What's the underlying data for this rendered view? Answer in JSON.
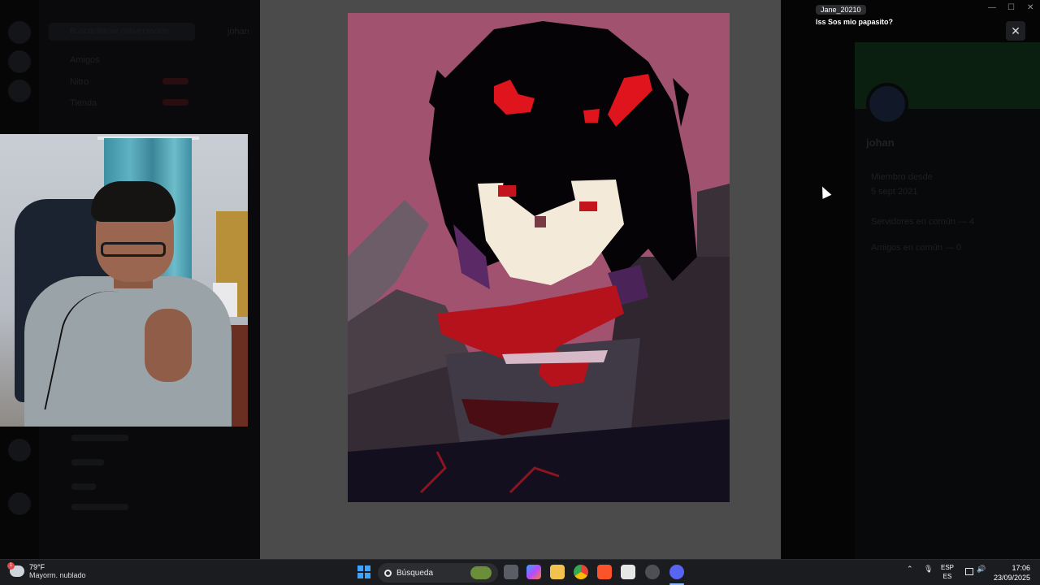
{
  "background_app": {
    "search_placeholder": "Buscar/iniciar conversación",
    "header_user": "johan",
    "nav_items": [
      "Amigos",
      "Nitro",
      "Tienda"
    ],
    "profile_name": "johan",
    "profile_member_since_label": "Miembro desde",
    "profile_member_since": "5 sept 2021",
    "profile_mutual_servers": "Servidores en común — 4",
    "profile_mutual_friends": "Amigos en común — 0"
  },
  "viewer": {
    "image_alt": "pixel-art-portrait"
  },
  "notification": {
    "username": "Jane_20210",
    "message": "Iss Sos mio papasito?"
  },
  "window": {
    "close_glyph": "✕",
    "minimize_glyph": "—",
    "maximize_glyph": "☐",
    "winclose_glyph": "✕"
  },
  "taskbar": {
    "weather_temp": "79°F",
    "weather_desc": "Mayorm. nublado",
    "weather_badge": "1",
    "search_label": "Búsqueda",
    "lang_top": "ESP",
    "lang_bottom": "ES",
    "time": "17:06",
    "date": "23/09/2025",
    "tray_up_glyph": "⌃",
    "mic_glyph": "🎙",
    "volume_glyph": "🔊",
    "apps": [
      "task-view",
      "copilot",
      "file-explorer",
      "chrome",
      "brave",
      "store",
      "app-7",
      "discord"
    ]
  },
  "colors": {
    "art_bg": "#a0526f",
    "viewer_bg": "#4b4b4b",
    "accent_red": "#c4141d",
    "taskbar_bg": "#1b1c1f"
  }
}
